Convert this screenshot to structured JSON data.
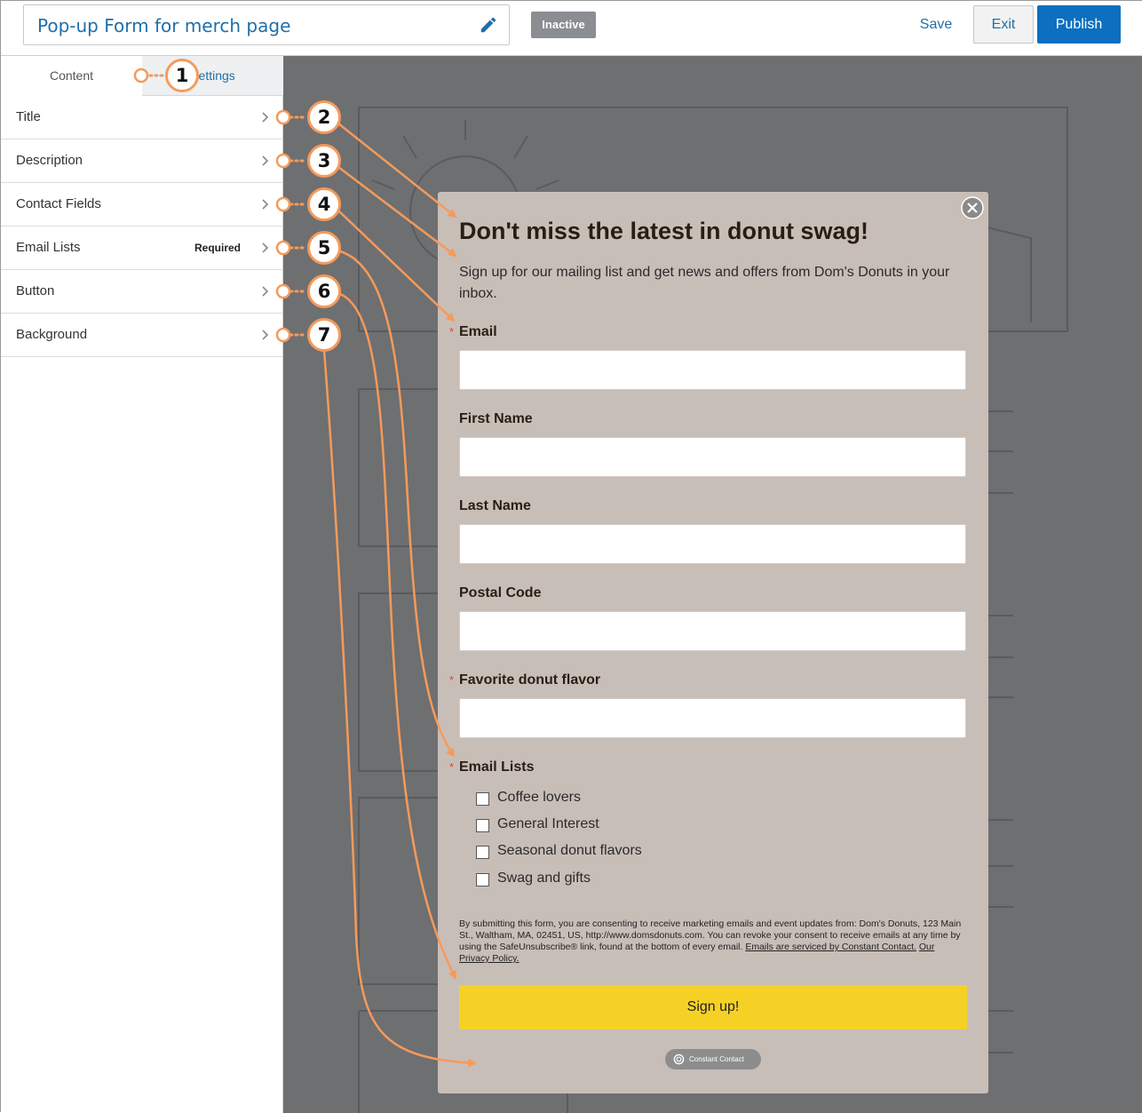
{
  "header": {
    "form_title": "Pop-up Form for merch page",
    "status_badge": "Inactive",
    "save_label": "Save",
    "exit_label": "Exit",
    "publish_label": "Publish"
  },
  "sidebar": {
    "tabs": [
      {
        "label": "Content"
      },
      {
        "label": "Settings"
      }
    ],
    "items": [
      {
        "label": "Title"
      },
      {
        "label": "Description"
      },
      {
        "label": "Contact Fields"
      },
      {
        "label": "Email Lists",
        "badge": "Required"
      },
      {
        "label": "Button"
      },
      {
        "label": "Background"
      }
    ]
  },
  "popup": {
    "title": "Don't miss the latest in donut swag!",
    "description": "Sign up for our mailing list and get news and offers from Dom's Donuts in your inbox.",
    "required_mark": "*",
    "fields": [
      {
        "label": "Email",
        "required": true
      },
      {
        "label": "First Name",
        "required": false
      },
      {
        "label": "Last Name",
        "required": false
      },
      {
        "label": "Postal Code",
        "required": false
      },
      {
        "label": "Favorite donut flavor",
        "required": true
      }
    ],
    "email_lists_label": "Email Lists",
    "lists": [
      "Coffee lovers",
      "General Interest",
      "Seasonal donut flavors",
      "Swag and gifts"
    ],
    "consent_text": "By submitting this form, you are consenting to receive marketing emails and event updates from: Dom's Donuts, 123 Main St., Waltham, MA, 02451, US, http://www.domsdonuts.com. You can revoke your consent to receive emails at any time by using the SafeUnsubscribe® link, found at the bottom of every email.",
    "consent_link_1": "Emails are serviced by Constant Contact.",
    "consent_link_2": "Our Privacy Policy.",
    "button_label": "Sign up!",
    "brand_badge": "Constant Contact"
  },
  "callouts": [
    "1",
    "2",
    "3",
    "4",
    "5",
    "6",
    "7"
  ],
  "colors": {
    "accent_blue": "#0d6fbf",
    "link_blue": "#1f6fa8",
    "popup_background": "#c8beb8",
    "button_yellow": "#f6d125",
    "callout_orange": "#f59a5b",
    "canvas_gray": "#6e6f71"
  }
}
